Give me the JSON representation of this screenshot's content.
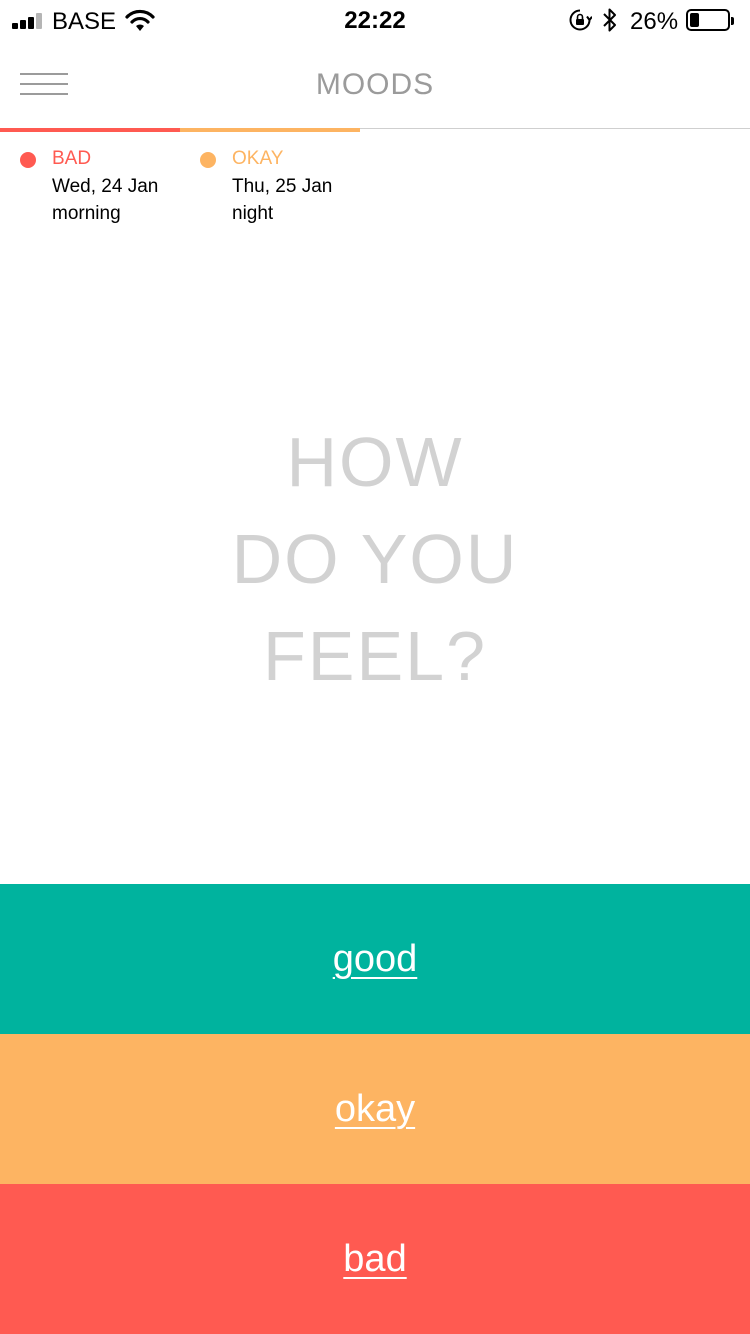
{
  "status_bar": {
    "carrier": "BASE",
    "time": "22:22",
    "battery_percent": "26%",
    "battery_level": 0.26,
    "signal_bars_filled": 3,
    "icons": [
      "signal-icon",
      "wifi-icon",
      "orientation-lock-icon",
      "bluetooth-icon",
      "battery-icon"
    ]
  },
  "nav": {
    "title": "MOODS",
    "menu_icon": "hamburger-menu-icon"
  },
  "history": [
    {
      "mood": "BAD",
      "date": "Wed, 24 Jan",
      "period": "morning",
      "color": "#ff5a51"
    },
    {
      "mood": "OKAY",
      "date": "Thu, 25 Jan",
      "period": "night",
      "color": "#fdb462"
    }
  ],
  "prompt": {
    "line1": "HOW",
    "line2": "DO YOU",
    "line3": "FEEL?"
  },
  "mood_buttons": [
    {
      "label": "good",
      "color": "#00b39e"
    },
    {
      "label": "okay",
      "color": "#fdb462"
    },
    {
      "label": "bad",
      "color": "#ff5a51"
    }
  ]
}
